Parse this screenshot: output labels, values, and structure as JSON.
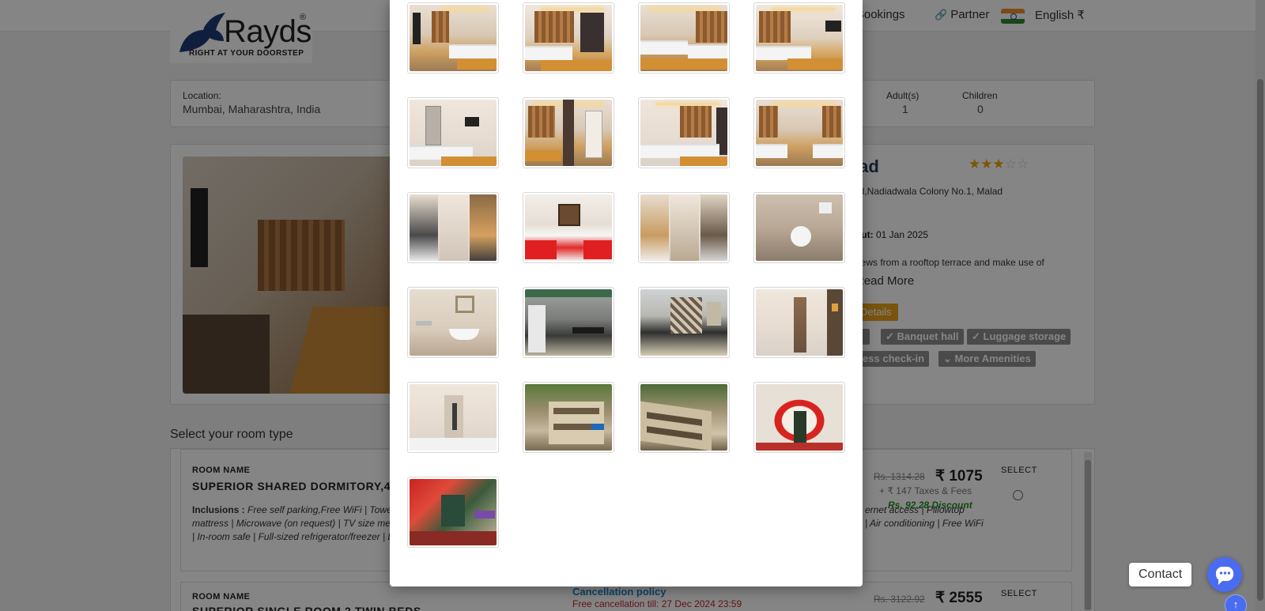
{
  "header": {
    "brand_name": "Rayds",
    "brand_reg": "®",
    "tagline": "RIGHT AT YOUR DOORSTEP",
    "nav_bookings": "ge Bookings",
    "nav_partner": "Partner",
    "language": "English ₹"
  },
  "search": {
    "location_label": "Location:",
    "location_value": "Mumbai, Maharashtra, India",
    "adults_label": "Adult(s)",
    "adults_value": "1",
    "children_label": "Children",
    "children_value": "0"
  },
  "hotel": {
    "title_fragment": "lad",
    "stars_filled": "★★★",
    "stars_empty": "☆☆",
    "rating": 3,
    "address_fragment": "ad,Nadiadwala Colony No.1, Malad",
    "checkout_label": "Out:",
    "checkout_value": "01 Jan 2025",
    "desc_fragment": "views from a rooftop terrace and make use of",
    "read_more": "Read More",
    "details_button": "Details",
    "amenities": [
      "✓ Banquet hall",
      "✓ Luggage storage",
      "ress check-in",
      "⌄ More Amenities"
    ]
  },
  "rooms_section": {
    "title": "Select your room type",
    "rooms": [
      {
        "label": "ROOM NAME",
        "name": "SUPERIOR SHARED DORMITORY,4",
        "inclusions_label": "Inclusions :",
        "inclusions_line1": "Free self parking,Free WiFi | Towe",
        "inclusions_line2": "mattress | Microwave (on request) | TV size me",
        "inclusions_line3": "| In-room safe | Full-sized refrigerator/freezer | L",
        "right_line1": "ernet access | Pillowtop",
        "right_line2": "| Air conditioning | Free WiFi",
        "old_price": "Rs. 1314.28",
        "price": "₹ 1075",
        "taxes": "+ ₹ 147 Taxes & Fees",
        "discount": "Rs. 92.28 Discount",
        "select_label": "SELECT"
      },
      {
        "label": "ROOM NAME",
        "name": "SUPERIOR SINGLE ROOM 2 TWIN BEDS",
        "cancel_title": "Cancellation policy",
        "cancel_text": "Free cancellation till: 27 Dec 2024 23:59",
        "old_price": "Rs. 3122.92",
        "price": "₹ 2555",
        "select_label": "SELECT"
      }
    ]
  },
  "gallery": {
    "photos": [
      "room-tv-curtains",
      "room-twin-beds",
      "room-twin-beds-wide",
      "room-tv-beds",
      "room-mirror-desk",
      "room-curtains-door",
      "room-long-bed",
      "room-two-beds",
      "room-collage",
      "room-red-pillows",
      "room-collage-2",
      "bathroom-shower",
      "bathroom-sink",
      "kitchen",
      "kitchen-2",
      "corridor",
      "corridor-2",
      "exterior",
      "exterior-2",
      "entrance-arch",
      "entrance-lobby"
    ]
  },
  "contact": {
    "label": "Contact",
    "up_arrow": "↑"
  }
}
